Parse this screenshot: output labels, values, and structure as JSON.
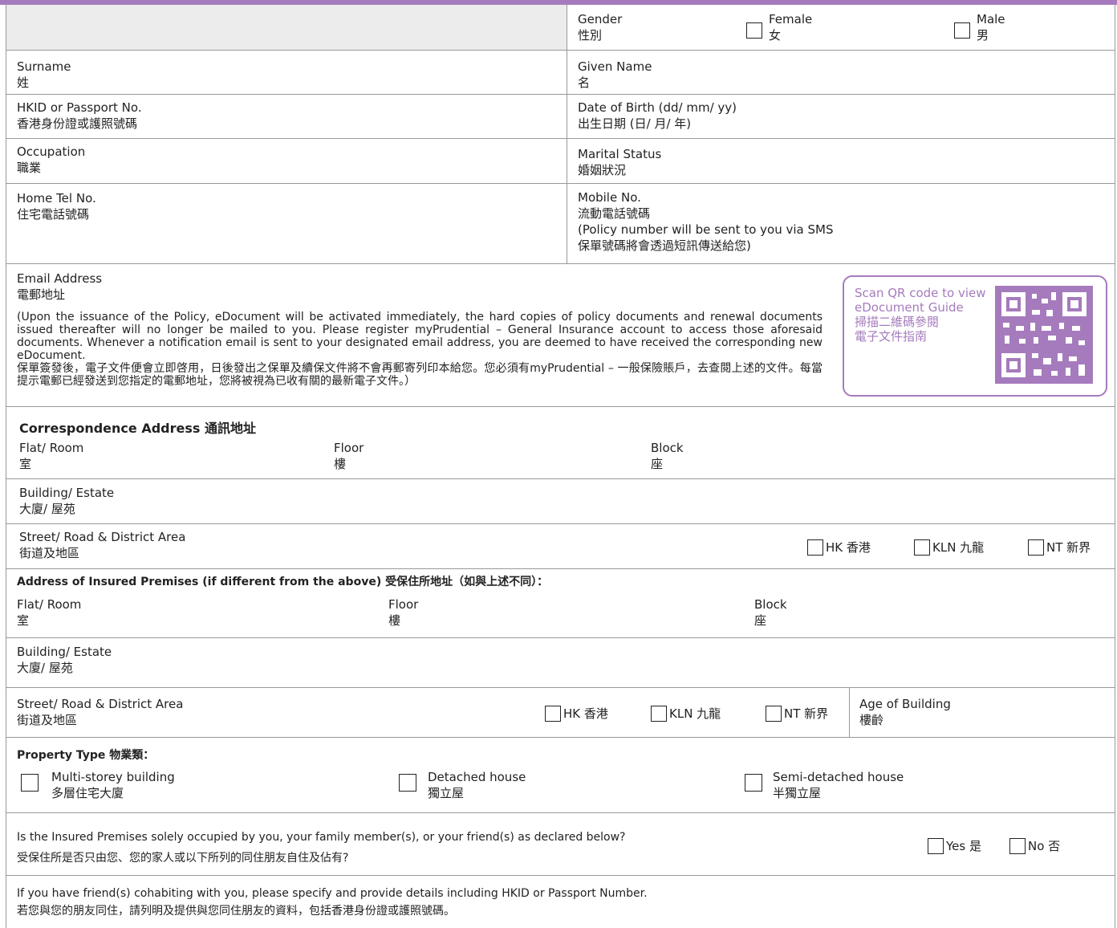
{
  "gender": {
    "label_en": "Gender",
    "label_zh": "性別",
    "female_en": "Female",
    "female_zh": "女",
    "male_en": "Male",
    "male_zh": "男"
  },
  "surname": {
    "en": "Surname",
    "zh": "姓"
  },
  "given_name": {
    "en": "Given Name",
    "zh": "名"
  },
  "hkid": {
    "en": "HKID or Passport No.",
    "zh": "香港身份證或護照號碼"
  },
  "dob": {
    "en": "Date of Birth (dd/ mm/ yy)",
    "zh": "出生日期 (日/ 月/ 年)"
  },
  "occupation": {
    "en": "Occupation",
    "zh": "職業"
  },
  "marital": {
    "en": "Marital Status",
    "zh": "婚姻狀況"
  },
  "home_tel": {
    "en": "Home Tel No.",
    "zh": "住宅電話號碼"
  },
  "mobile": {
    "en": "Mobile No.",
    "zh": "流動電話號碼",
    "note_en": "(Policy number will be sent to you via SMS",
    "note_zh": "保單號碼將會透過短訊傳送給您)"
  },
  "email": {
    "en": "Email Address",
    "zh": "電郵地址",
    "note_en": "(Upon the issuance of the Policy, eDocument will be activated immediately, the hard copies of policy documents and renewal documents issued thereafter will no longer be mailed to you. Please register myPrudential – General Insurance account to access those aforesaid documents.  Whenever a notification email is sent to your designated email address, you are deemed to have received the corresponding new eDocument.",
    "note_zh": "保單簽發後，電子文件便會立即啓用，日後發出之保單及續保文件將不會再郵寄列印本給您。您必須有myPrudential – 一般保險賬戶，去查閱上述的文件。每當提示電郵已經發送到您指定的電郵地址，您將被視為已收有關的最新電子文件。）"
  },
  "qr": {
    "line1": "Scan QR code to view",
    "line2": "eDocument Guide",
    "line3": "掃描二維碼參閱",
    "line4": "電子文件指南",
    "color": "#a57bbd"
  },
  "corr": {
    "title": "Correspondence Address 通訊地址"
  },
  "ins": {
    "title": "Address of Insured Premises (if different from the above) 受保住所地址（如與上述不同）："
  },
  "addr": {
    "flat_en": "Flat/ Room",
    "flat_zh": "室",
    "floor_en": "Floor",
    "floor_zh": "樓",
    "block_en": "Block",
    "block_zh": "座",
    "bldg_en": "Building/ Estate",
    "bldg_zh": "大廈/ 屋苑",
    "street_en": "Street/ Road & District Area",
    "street_zh": "街道及地區",
    "hk": "HK 香港",
    "kln": "KLN 九龍",
    "nt": "NT 新界"
  },
  "age": {
    "en": "Age of Building",
    "zh": "樓齡"
  },
  "property": {
    "title": "Property Type 物業類：",
    "multi_en": "Multi-storey building",
    "multi_zh": "多層住宅大廈",
    "detached_en": "Detached house",
    "detached_zh": "獨立屋",
    "semi_en": "Semi-detached house",
    "semi_zh": "半獨立屋"
  },
  "occupied": {
    "q_en": "Is the Insured Premises solely occupied by you, your family member(s), or your friend(s) as declared below?",
    "q_zh": "受保住所是否只由您、您的家人或以下所列的同住朋友自住及佔有?",
    "yes": "Yes 是",
    "no": "No 否"
  },
  "cohabit": {
    "en": "If you have friend(s) cohabiting with you, please specify and provide details including HKID or Passport Number.",
    "zh": "若您與您的朋友同住，請列明及提供與您同住朋友的資料，包括香港身份證或護照號碼。"
  }
}
